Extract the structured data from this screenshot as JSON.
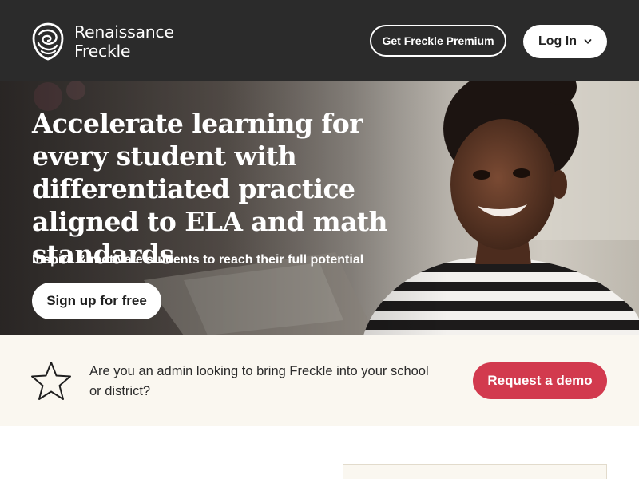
{
  "header": {
    "logo": {
      "line1": "Renaissance",
      "line2": "Freckle"
    },
    "premium_label": "Get Freckle Premium",
    "login_label": "Log In"
  },
  "hero": {
    "title": "Accelerate learning for every student with differentiated practice aligned to ELA and math standards",
    "subtitle": "Inspire & motivate students to reach their full potential",
    "signup_label": "Sign up for free"
  },
  "admin_banner": {
    "text": "Are you an admin looking to bring Freckle into your school or district?",
    "demo_label": "Request a demo"
  },
  "icons": {
    "logo_mark": "renaissance-swirl-icon",
    "login_chevron": "chevron-down-icon",
    "admin_star": "star-outline-icon"
  },
  "colors": {
    "header_bg": "#2b2b2b",
    "demo_button": "#d23a4e",
    "banner_bg": "#faf7f0"
  }
}
